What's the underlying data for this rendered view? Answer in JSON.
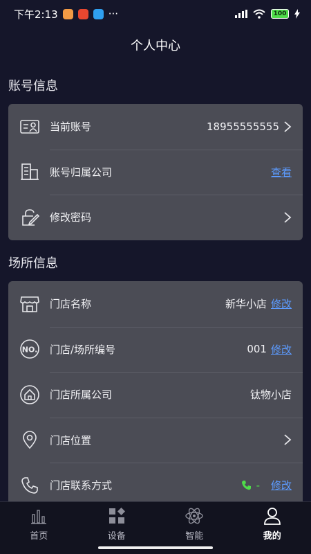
{
  "status_bar": {
    "time": "下午2:13",
    "more": "···",
    "battery": "100",
    "app_colors": [
      "#f39b45",
      "#e8472f",
      "#2fa0f0"
    ]
  },
  "header": {
    "title": "个人中心"
  },
  "account": {
    "title": "账号信息",
    "rows": [
      {
        "icon": "id-card-icon",
        "label": "当前账号",
        "value": "18955555555",
        "link": "",
        "chevron": true
      },
      {
        "icon": "building-icon",
        "label": "账号归属公司",
        "value": "",
        "link": "查看",
        "chevron": false
      },
      {
        "icon": "lock-edit-icon",
        "label": "修改密码",
        "value": "",
        "link": "",
        "chevron": true
      }
    ]
  },
  "venue": {
    "title": "场所信息",
    "rows": [
      {
        "icon": "storefront-icon",
        "label": "门店名称",
        "value": "新华小店",
        "link": "修改",
        "chevron": false
      },
      {
        "icon": "number-badge-icon",
        "label": "门店/场所编号",
        "value": "001",
        "link": "修改",
        "chevron": false
      },
      {
        "icon": "home-circle-icon",
        "label": "门店所属公司",
        "value": "钛物小店",
        "link": "",
        "chevron": false
      },
      {
        "icon": "location-pin-icon",
        "label": "门店位置",
        "value": "",
        "link": "",
        "chevron": true
      },
      {
        "icon": "phone-icon",
        "label": "门店联系方式",
        "value": "",
        "link": "修改",
        "chevron": false,
        "phone_status": "-"
      }
    ]
  },
  "tab_bar": {
    "tabs": [
      {
        "icon": "bar-chart-icon",
        "label": "首页",
        "active": false
      },
      {
        "icon": "grid-icon",
        "label": "设备",
        "active": false
      },
      {
        "icon": "atom-icon",
        "label": "智能",
        "active": false
      },
      {
        "icon": "user-icon",
        "label": "我的",
        "active": true
      }
    ]
  },
  "colors": {
    "background": "#15162a",
    "card": "#4b4c55",
    "link": "#5c9bff",
    "phone_green": "#4fdc4a"
  }
}
